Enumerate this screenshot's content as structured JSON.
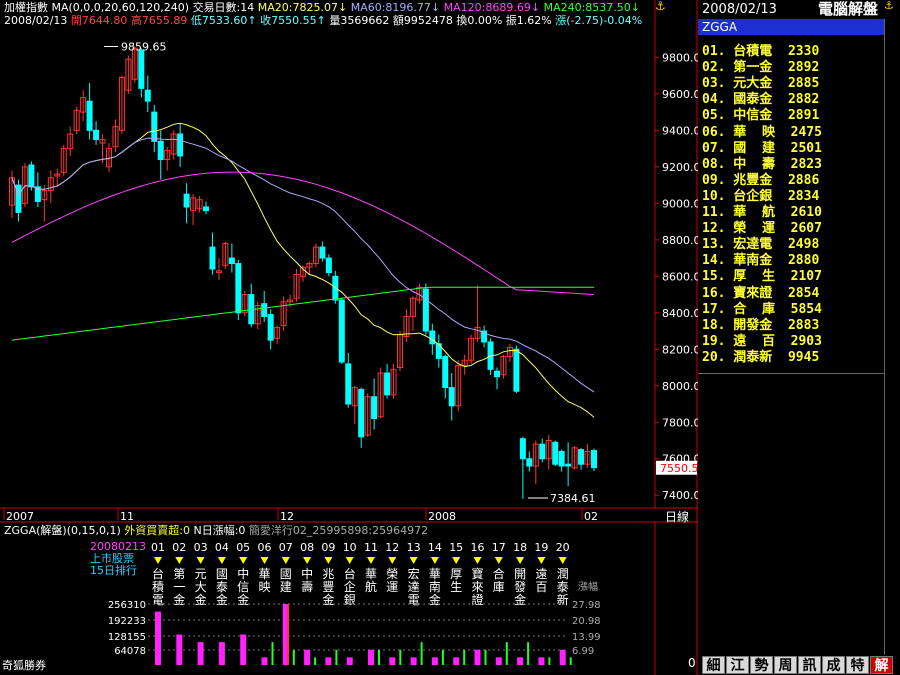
{
  "header": {
    "index_name": "加權指數",
    "ma_spec": "MA(0,0,0,20,60,120,240)",
    "trade_days": "交易日數:14",
    "ma20": "MA20:7825.07",
    "ma20_arrow": "↓",
    "ma60": "MA60:8196.77",
    "ma60_arrow": "↓",
    "ma120": "MA120:8689.69",
    "ma120_arrow": "↓",
    "ma240": "MA240:8537.50",
    "ma240_arrow": "↓",
    "date": "2008/02/13",
    "open": "開7644.80",
    "high": "高7655.89",
    "low": "低7533.60",
    "close": "收7550.55",
    "volume": "量3569662",
    "amount": "額9952478",
    "turnover": "換0.00%",
    "amplitude": "振1.62%",
    "change": "漲(-2.75)-0.04%",
    "up_arrow": "↑"
  },
  "chart": {
    "y_ticks": [
      "9800.0",
      "9600.0",
      "9400.0",
      "9200.0",
      "9000.0",
      "8800.0",
      "8600.0",
      "8400.0",
      "8200.0",
      "8000.0",
      "7800.0",
      "7600.0",
      "7400.0"
    ],
    "x_labels": [
      "2007",
      "11",
      "12",
      "2008",
      "02"
    ],
    "period_label": "日線",
    "high_annotation": "9859.65",
    "low_annotation": "7384.61",
    "current_price": "7550.5"
  },
  "chart_data": {
    "type": "candlestick",
    "ylim": [
      7330,
      9950
    ],
    "ma_series": [
      "MA20",
      "MA60",
      "MA120",
      "MA240"
    ],
    "candles": [
      [
        8990,
        9180,
        8920,
        9140
      ],
      [
        9100,
        9130,
        8900,
        8950
      ],
      [
        9000,
        9220,
        8980,
        9200
      ],
      [
        9210,
        9230,
        9070,
        9090
      ],
      [
        9090,
        9170,
        8980,
        9010
      ],
      [
        9020,
        9100,
        8900,
        9070
      ],
      [
        9070,
        9180,
        9000,
        9140
      ],
      [
        9150,
        9190,
        9090,
        9160
      ],
      [
        9170,
        9320,
        9150,
        9300
      ],
      [
        9300,
        9420,
        9260,
        9380
      ],
      [
        9400,
        9530,
        9380,
        9510
      ],
      [
        9500,
        9620,
        9450,
        9580
      ],
      [
        9560,
        9660,
        9350,
        9400
      ],
      [
        9400,
        9450,
        9320,
        9350
      ],
      [
        9330,
        9380,
        9220,
        9350
      ],
      [
        9200,
        9330,
        9170,
        9300
      ],
      [
        9310,
        9460,
        9280,
        9420
      ],
      [
        9400,
        9700,
        9380,
        9690
      ],
      [
        9620,
        9810,
        9600,
        9790
      ],
      [
        9680,
        9860,
        9660,
        9850
      ],
      [
        9840,
        9850,
        9580,
        9630
      ],
      [
        9620,
        9700,
        9500,
        9560
      ],
      [
        9500,
        9540,
        9280,
        9340
      ],
      [
        9340,
        9400,
        9130,
        9240
      ],
      [
        9240,
        9310,
        9180,
        9290
      ],
      [
        9270,
        9400,
        9240,
        9380
      ],
      [
        9380,
        9440,
        9200,
        9260
      ],
      [
        9050,
        9110,
        8890,
        8980
      ],
      [
        8960,
        9050,
        8880,
        9030
      ],
      [
        8970,
        9040,
        8950,
        9020
      ],
      [
        8980,
        9010,
        8940,
        8960
      ],
      [
        8760,
        8840,
        8610,
        8640
      ],
      [
        8620,
        8700,
        8580,
        8630
      ],
      [
        8660,
        8790,
        8640,
        8780
      ],
      [
        8700,
        8780,
        8620,
        8670
      ],
      [
        8670,
        8690,
        8360,
        8400
      ],
      [
        8400,
        8520,
        8380,
        8500
      ],
      [
        8500,
        8560,
        8320,
        8340
      ],
      [
        8340,
        8460,
        8310,
        8440
      ],
      [
        8450,
        8520,
        8350,
        8380
      ],
      [
        8390,
        8420,
        8200,
        8250
      ],
      [
        8260,
        8330,
        8230,
        8320
      ],
      [
        8330,
        8490,
        8300,
        8460
      ],
      [
        8460,
        8500,
        8430,
        8470
      ],
      [
        8480,
        8640,
        8460,
        8610
      ],
      [
        8600,
        8660,
        8570,
        8650
      ],
      [
        8650,
        8680,
        8610,
        8670
      ],
      [
        8670,
        8780,
        8650,
        8760
      ],
      [
        8760,
        8790,
        8680,
        8700
      ],
      [
        8700,
        8720,
        8600,
        8620
      ],
      [
        8600,
        8630,
        8450,
        8470
      ],
      [
        8470,
        8480,
        8120,
        8130
      ],
      [
        8120,
        8180,
        7880,
        7900
      ],
      [
        7890,
        8000,
        7790,
        7990
      ],
      [
        7980,
        7990,
        7660,
        7720
      ],
      [
        7730,
        7960,
        7720,
        7940
      ],
      [
        7940,
        8040,
        7760,
        7820
      ],
      [
        7830,
        8100,
        7820,
        8070
      ],
      [
        8070,
        8120,
        7930,
        7950
      ],
      [
        7950,
        8120,
        7930,
        8090
      ],
      [
        8100,
        8300,
        8080,
        8280
      ],
      [
        8270,
        8420,
        8240,
        8380
      ],
      [
        8380,
        8490,
        8300,
        8480
      ],
      [
        8470,
        8560,
        8450,
        8540
      ],
      [
        8530,
        8560,
        8280,
        8300
      ],
      [
        8300,
        8340,
        8170,
        8230
      ],
      [
        8230,
        8280,
        8100,
        8150
      ],
      [
        8160,
        8170,
        7930,
        7990
      ],
      [
        7990,
        8070,
        7810,
        7890
      ],
      [
        7890,
        8140,
        7860,
        8110
      ],
      [
        8110,
        8170,
        8060,
        8140
      ],
      [
        8140,
        8280,
        8120,
        8260
      ],
      [
        8260,
        8550,
        8240,
        8320
      ],
      [
        8300,
        8330,
        8210,
        8240
      ],
      [
        8240,
        8260,
        8060,
        8090
      ],
      [
        8080,
        8100,
        7980,
        8050
      ],
      [
        8060,
        8170,
        8040,
        8160
      ],
      [
        8160,
        8230,
        8130,
        8210
      ],
      [
        8200,
        8220,
        7960,
        7970
      ],
      [
        7710,
        7720,
        7380,
        7600
      ],
      [
        7600,
        7640,
        7530,
        7560
      ],
      [
        7560,
        7700,
        7460,
        7680
      ],
      [
        7680,
        7710,
        7580,
        7600
      ],
      [
        7600,
        7730,
        7540,
        7700
      ],
      [
        7690,
        7700,
        7560,
        7570
      ],
      [
        7640,
        7650,
        7530,
        7560
      ],
      [
        7570,
        7690,
        7450,
        7560
      ],
      [
        7550,
        7670,
        7540,
        7660
      ],
      [
        7650,
        7660,
        7540,
        7570
      ],
      [
        7570,
        7680,
        7550,
        7640
      ],
      [
        7645,
        7656,
        7533,
        7551
      ]
    ]
  },
  "indicator": {
    "title": "ZGGA(解盤)(0,15,0,1)",
    "foreign_label": "外資買賣超:0",
    "n_days": "N日漲幅:0",
    "legend": "簡愛洋行02_25995898:25964972",
    "date_text": "20080213",
    "line2": "上市股票",
    "line3": "15日排行",
    "pct_header": "漲幅",
    "volume_ticks": [
      "256310",
      "192233",
      "128155",
      "64078"
    ],
    "pct_ticks": [
      "27.98",
      "20.98",
      "13.99",
      "6.99"
    ],
    "right_value": "0",
    "rank_numbers": [
      "01",
      "02",
      "03",
      "04",
      "05",
      "06",
      "07",
      "08",
      "09",
      "10",
      "11",
      "12",
      "13",
      "14",
      "15",
      "16",
      "17",
      "18",
      "19",
      "20"
    ],
    "stock_names": [
      "台積電",
      "第一金",
      "元大金",
      "國泰金",
      "中信金",
      "華映",
      "國建",
      "中壽",
      "兆豐金",
      "台企銀",
      "華航",
      "榮運",
      "宏達電",
      "華南金",
      "厚生",
      "寶來證",
      "合庫",
      "開發金",
      "遠百",
      "潤泰新"
    ],
    "bars_magenta": [
      7,
      4,
      3,
      3,
      4,
      1,
      8,
      2,
      1,
      1,
      2,
      1,
      1,
      1,
      1,
      2,
      1,
      1,
      1,
      2
    ],
    "bars_green": [
      0,
      0,
      0,
      0,
      0,
      3,
      2,
      1,
      2,
      0,
      2,
      2,
      3,
      2,
      2,
      2,
      3,
      3,
      1,
      1
    ]
  },
  "right_panel": {
    "date": "2008/02/13",
    "title": "電腦解盤",
    "list_header": "ZGGA",
    "rows": [
      "01. 台積電  2330",
      "02. 第一金  2892",
      "03. 元大金  2885",
      "04. 國泰金  2882",
      "05. 中信金  2891",
      "06. 華  映  2475",
      "07. 國  建  2501",
      "08. 中  壽  2823",
      "09. 兆豐金  2886",
      "10. 台企銀  2834",
      "11. 華  航  2610",
      "12. 榮  運  2607",
      "13. 宏達電  2498",
      "14. 華南金  2880",
      "15. 厚  生  2107",
      "16. 寶來證  2854",
      "17. 合  庫  5854",
      "18. 開發金  2883",
      "19. 遠  百  2903",
      "20. 潤泰新  9945"
    ],
    "tabs": [
      "細",
      "江",
      "勢",
      "周",
      "訊",
      "成",
      "特",
      "解"
    ]
  },
  "footer": {
    "broker": "奇狐勝券"
  },
  "colors": {
    "up": "#ff3333",
    "down": "#00ffff",
    "ma20": "#ffff66",
    "ma60": "#aaaaff",
    "ma120": "#ff44ff",
    "ma240": "#33ff33",
    "axis": "#cc0000",
    "list_text": "#ffff33",
    "list_header_bg": "#1e2fd2"
  }
}
